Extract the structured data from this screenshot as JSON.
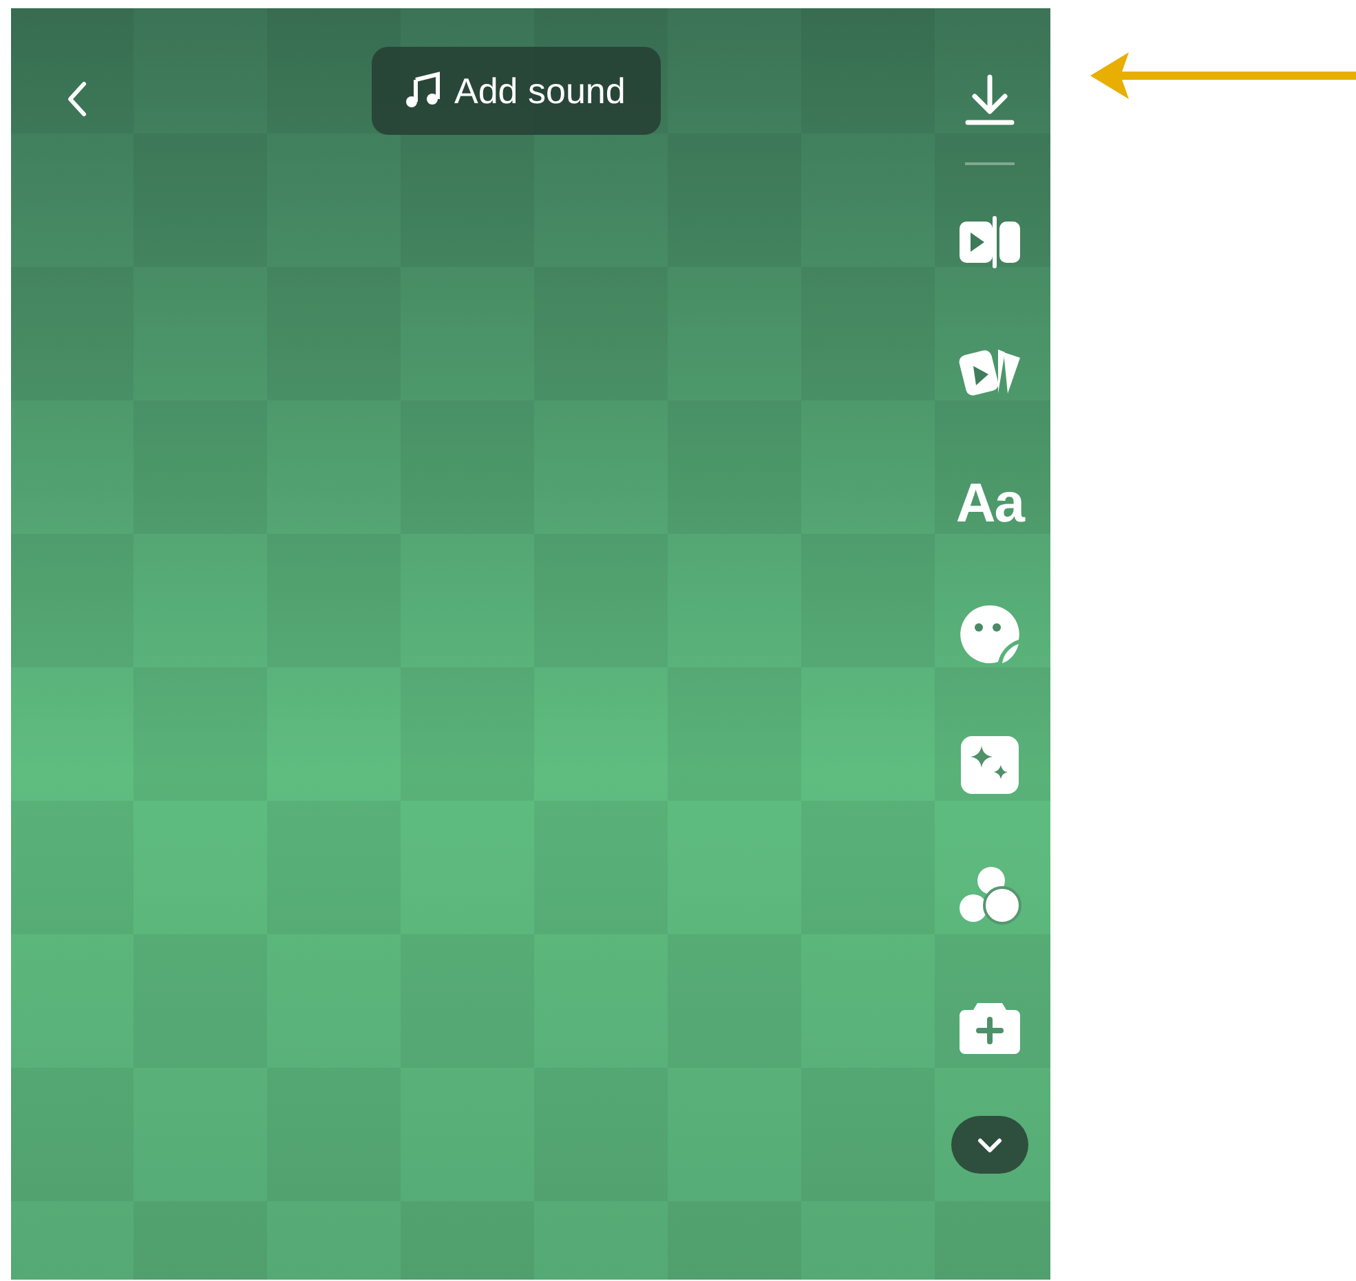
{
  "top_bar": {
    "add_sound": {
      "label": "Add sound"
    }
  },
  "tools": [
    {
      "kind": "download"
    },
    {
      "kind": "divider"
    },
    {
      "kind": "clip"
    },
    {
      "kind": "cards"
    },
    {
      "kind": "text",
      "label": "Aa"
    },
    {
      "kind": "sticker"
    },
    {
      "kind": "effects"
    },
    {
      "kind": "filters"
    },
    {
      "kind": "camera"
    },
    {
      "kind": "more"
    }
  ],
  "annotation": {
    "kind": "arrow"
  }
}
